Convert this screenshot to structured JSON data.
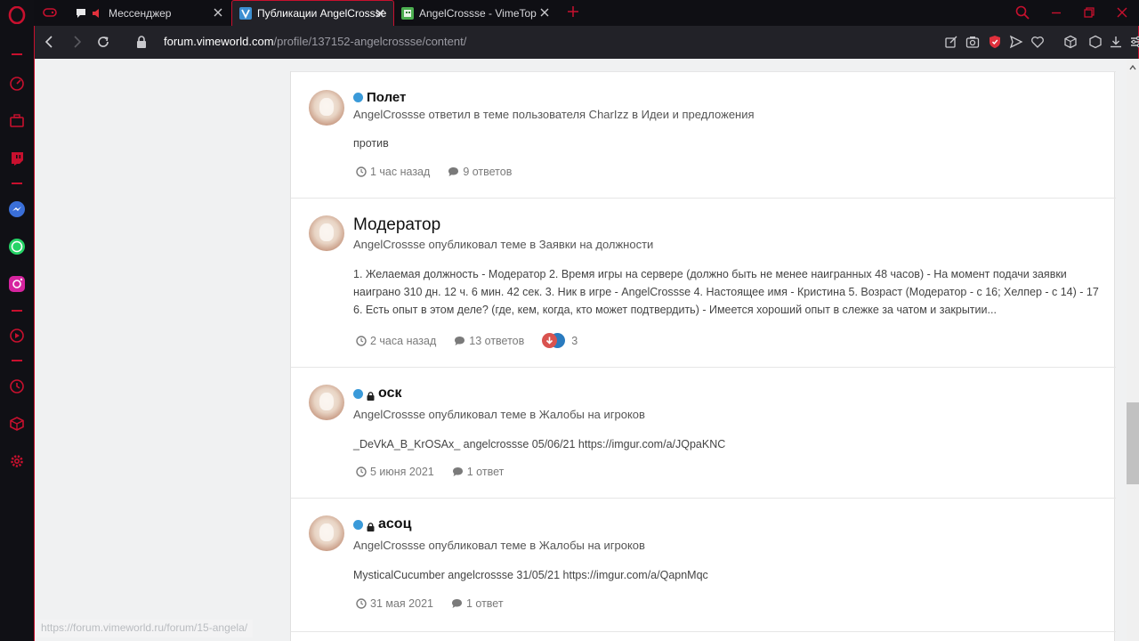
{
  "browser": {
    "tabs": [
      {
        "label": "Мессенджер",
        "icon": "messenger-icon",
        "audio": true
      },
      {
        "label": "Публикации AngelCrossse",
        "icon": "vimeworld-favicon"
      },
      {
        "label": "AngelCrossse - VimeTop",
        "icon": "vimetop-favicon"
      }
    ],
    "url_host": "forum.vimeworld.com",
    "url_path": "/profile/137152-angelcrossse/content/",
    "status_link": "https://forum.vimeworld.ru/forum/15-angela/",
    "accent_color": "#c8102e"
  },
  "posts": [
    {
      "title": "Полет",
      "unread": true,
      "locked": false,
      "meta": "AngelCrossse ответил в теме пользователя CharIzz в Идеи и предложения",
      "snippet": "против",
      "time": "1 час назад",
      "replies": "9 ответов"
    },
    {
      "title": "Модератор",
      "unread": false,
      "locked": false,
      "meta": "AngelCrossse опубликовал теме в Заявки на должности",
      "snippet": "1. Желаемая должность - Модератор 2. Время игры на сервере (должно быть не менее наигранных 48 часов) - На момент подачи заявки наиграно 310 дн. 12 ч. 6 мин. 42 сек. 3. Ник в игре - AngelCrossse 4. Настоящее имя - Кристина 5. Возраст (Модератор - с 16; Хелпер - с 14) - 17 6. Есть опыт в этом деле? (где, кем, когда, кто может подтвердить) - Имеется хороший опыт в слежке за чатом и закрытии...",
      "time": "2 часа назад",
      "replies": "13 ответов",
      "reactions": "3"
    },
    {
      "title": "оск",
      "unread": true,
      "locked": true,
      "meta": "AngelCrossse опубликовал теме в Жалобы на игроков",
      "snippet": "_DeVkA_B_KrOSAx_ angelcrossse 05/06/21 https://imgur.com/a/JQpaKNC",
      "time": "5 июня 2021",
      "replies": "1 ответ"
    },
    {
      "title": "асоц",
      "unread": true,
      "locked": true,
      "meta": "AngelCrossse опубликовал теме в Жалобы на игроков",
      "snippet": "MysticalCucumber angelcrossse 31/05/21 https://imgur.com/a/QapnMqc",
      "time": "31 мая 2021",
      "replies": "1 ответ"
    }
  ]
}
